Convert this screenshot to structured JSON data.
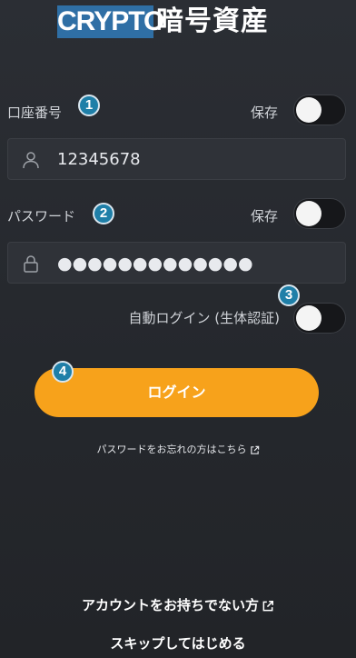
{
  "header": {
    "logo_en": "CRYPTO",
    "logo_jp": "暗号資産"
  },
  "account": {
    "label": "口座番号",
    "badge": "1",
    "save_label": "保存",
    "value": "12345678"
  },
  "password": {
    "label": "パスワード",
    "badge": "2",
    "save_label": "保存",
    "masked_value": "●●●●●●●●●●●●●"
  },
  "auto_login": {
    "label": "自動ログイン (生体認証)",
    "badge": "3"
  },
  "login": {
    "badge": "4",
    "button_label": "ログイン"
  },
  "links": {
    "forgot_password": "パスワードをお忘れの方はこちら",
    "no_account": "アカウントをお持ちでない方",
    "skip": "スキップしてはじめる"
  },
  "colors": {
    "accent": "#f7a21b",
    "badge": "#1f7fa8",
    "logo": "#2f6fa5",
    "background": "#2a2d33"
  },
  "icons": {
    "account_field": "user-icon",
    "password_field": "lock-icon",
    "external_link": "external-link-icon"
  }
}
